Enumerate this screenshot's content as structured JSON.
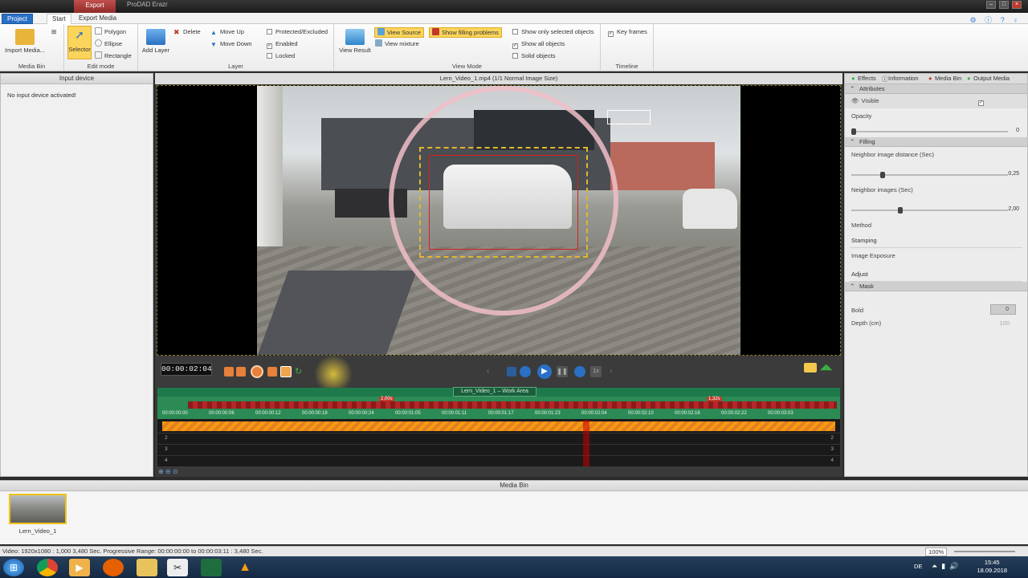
{
  "titlebar": {
    "context_tab": "Export",
    "app_name": "ProDAD Erazr",
    "min": "–",
    "max": "□",
    "close": "×"
  },
  "tabs": {
    "project": "Project",
    "start": "Start",
    "export_media": "Export Media"
  },
  "ribbon": {
    "media_bin": {
      "import": "Import Media...",
      "label": "Media Bin"
    },
    "edit_mode": {
      "selector": "Selector",
      "polygon": "Polygon",
      "ellipse": "Ellipse",
      "rectangle": "Rectangle",
      "label": "Edit mode"
    },
    "layer": {
      "add_layer": "Add Layer",
      "delete": "Delete",
      "move_up": "Move Up",
      "move_down": "Move Down",
      "protected": "Protected/Excluded",
      "enabled": "Enabled",
      "locked": "Locked",
      "label": "Layer"
    },
    "view_mode": {
      "view_result": "View Result",
      "view_source": "View Source",
      "view_mixture": "View mixture",
      "show_filling": "Show filling problems",
      "show_selected": "Show only selected objects",
      "show_all": "Show all objects",
      "solid": "Solid objects",
      "label": "View Mode"
    },
    "timeline": {
      "key_frames": "Key frames",
      "label": "Timeline"
    }
  },
  "left_panel": {
    "title": "Input device",
    "message": "No input device activated!"
  },
  "viewer": {
    "title": "Lern_Video_1.mp4   (1/1  Normal Image Size)"
  },
  "controls": {
    "timecode": "00:00:02:04",
    "speed": "1x"
  },
  "timeline": {
    "work_area": "Lern_Video_1 – Work Area",
    "badge_left": "2,00s",
    "badge_right": "1,32s",
    "ticks": [
      "00:00:00:00",
      "00:00:00:06",
      "00:00:00:12",
      "00:00:00:18",
      "00:00:00:24",
      "00:00:01:05",
      "00:00:01:11",
      "00:00:01:17",
      "00:00:01:23",
      "00:00:02:04",
      "00:00:02:10",
      "00:00:02:16",
      "00:00:02:22",
      "00:00:03:03"
    ],
    "tracks": [
      "2",
      "3",
      "4"
    ]
  },
  "right_panel": {
    "tabs": [
      "Effects",
      "Information",
      "Media Bin",
      "Output Media"
    ],
    "attributes": "Attributes",
    "visible": "Visible",
    "opacity_label": "Opacity",
    "opacity_value": "0",
    "filling": "Filling",
    "neighbor_distance_label": "Neighbor image distance (Sec)",
    "neighbor_distance_value": "0,25",
    "neighbor_images_label": "Neighbor images (Sec)",
    "neighbor_images_value": "2,00",
    "method_label": "Method",
    "method_value": "Stamping",
    "exposure_label": "Image Exposure",
    "exposure_value": "Adjust",
    "mask": "Mask",
    "bold_label": "Bold",
    "bold_value": "0",
    "depth_label": "Depth (cm)",
    "depth_value": "100"
  },
  "media_bin": {
    "title": "Media Bin",
    "item": "Lern_Video_1"
  },
  "status": {
    "text": "Video: 1920x1080 : 1,000   3,480 Sec.  Progressive   Range: 00:00:00:00 to 00:00:03:11 : 3,480 Sec.",
    "zoom": "100%"
  },
  "taskbar": {
    "lang": "DE",
    "time": "15:45",
    "date": "18.09.2018"
  }
}
